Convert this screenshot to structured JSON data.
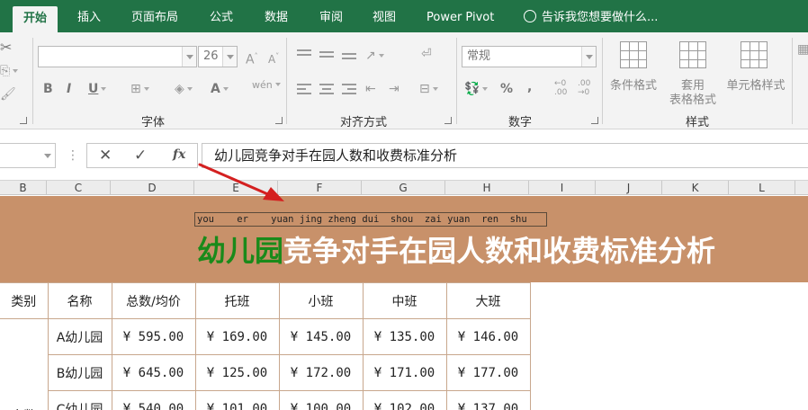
{
  "ribbon": {
    "tabs": [
      {
        "label": "开始",
        "active": true
      },
      {
        "label": "插入"
      },
      {
        "label": "页面布局"
      },
      {
        "label": "公式"
      },
      {
        "label": "数据"
      },
      {
        "label": "审阅"
      },
      {
        "label": "视图"
      },
      {
        "label": "Power Pivot"
      }
    ],
    "tell_me": "告诉我您想要做什么...",
    "font": {
      "name_value": "",
      "size_value": "26",
      "group_label": "字体"
    },
    "alignment": {
      "group_label": "对齐方式"
    },
    "number": {
      "format_value": "常规",
      "group_label": "数字"
    },
    "styles": {
      "conditional_format": "条件格式",
      "table_format_line1": "套用",
      "table_format_line2": "表格格式",
      "cell_styles": "单元格样式",
      "group_label": "样式"
    }
  },
  "formula_bar": {
    "content": "幼儿园竞争对手在园人数和收费标准分析"
  },
  "columns": [
    "B",
    "C",
    "D",
    "E",
    "F",
    "G",
    "H",
    "I",
    "J",
    "K",
    "L"
  ],
  "sheet": {
    "title_pinyin": "you    er    yuan jing zheng dui  shou  zai yuan  ren  shu",
    "title_highlight": "幼儿园",
    "title_rest": "竞争对手在园人数和收费标准分析",
    "headers": [
      "类别",
      "名称",
      "总数/均价",
      "托班",
      "小班",
      "中班",
      "大班"
    ],
    "rows": [
      {
        "name": "A幼儿园",
        "values": [
          "¥ 595.00",
          "¥ 169.00",
          "¥ 145.00",
          "¥ 135.00",
          "¥ 146.00"
        ]
      },
      {
        "name": "B幼儿园",
        "values": [
          "¥ 645.00",
          "¥ 125.00",
          "¥ 172.00",
          "¥ 171.00",
          "¥ 177.00"
        ]
      },
      {
        "name": "C幼儿园",
        "values": [
          "¥ 540.00",
          "¥ 101.00",
          "¥ 100.00",
          "¥ 102.00",
          "¥ 137.00"
        ]
      }
    ],
    "category_label": "人数"
  },
  "colors": {
    "ribbon_green": "#217346",
    "title_band": "#c8916a",
    "title_highlight": "#1a8a1a",
    "arrow": "#d42020"
  }
}
